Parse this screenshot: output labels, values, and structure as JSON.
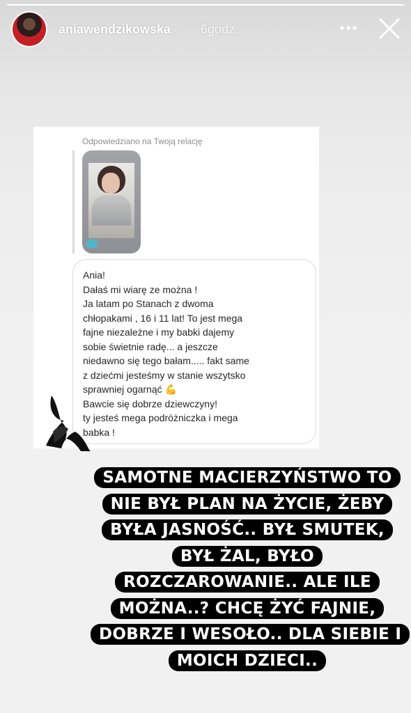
{
  "story": {
    "progress_fraction": 1.0,
    "username": "aniawendzikowska",
    "time_ago": "6godz.",
    "more_icon": "more-horizontal-icon",
    "close_icon": "close-icon"
  },
  "reply_card": {
    "label": "Odpowiedziano na Twoją relację",
    "story_sticker": "",
    "message": "Ania!\nDałaś mi wiarę ze można !\nJa latam po Stanach z dwoma\nchłopakami , 16 i 11 lat! To jest mega\nfajne niezależne i my babki dajemy\nsobie świetnie radę... a jeszcze\nniedawno się tego bałam.....  fakt same\nz dziećmi jesteśmy w stanie wszytsko\nsprawniej ogarnąć 💪\nBawcie się dobrze dziewczyny!\nty jesteś mega podróżniczka i mega\nbabka !"
  },
  "caption": {
    "text": "SAMOTNE MACIERZYŃSTWO TO NIE BYŁ PLAN NA ŻYCIE, ŻEBY BYŁA JASNOŚĆ.. BYŁ SMUTEK, BYŁ ŻAL, BYŁO ROZCZAROWANIE.. ALE ILE MOŻNA..? CHCĘ ŻYĆ FAJNIE, DOBRZE I WESOŁO.. DLA SIEBIE I MOICH DZIECI.."
  },
  "colors": {
    "caption_bg": "#000000",
    "caption_text": "#ffffff",
    "avatar_accent": "#c41f25",
    "bubble_border": "#dbdbdb"
  }
}
